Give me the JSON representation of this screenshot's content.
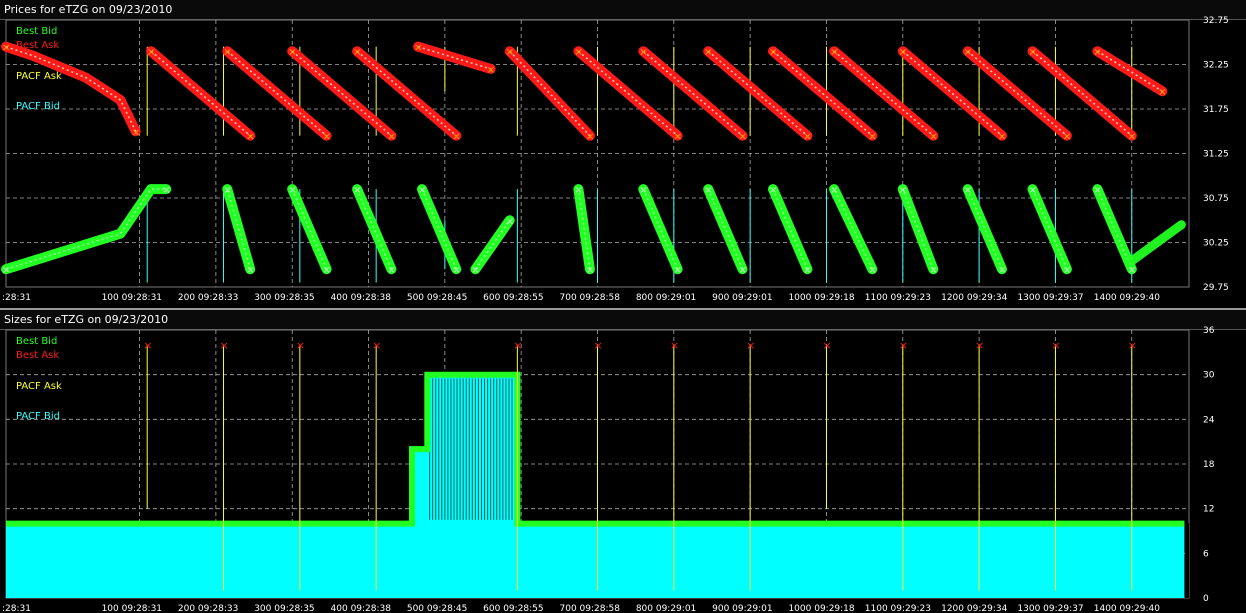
{
  "chart_data": [
    {
      "type": "line",
      "title": "Prices for  eTZG  on  09/23/2010",
      "x_tick_labels": [
        ":28:31",
        "100 09:28:31",
        "200 09:28:33",
        "300 09:28:35",
        "400 09:28:38",
        "500 09:28:45",
        "600 09:28:55",
        "700 09:28:58",
        "800 09:29:01",
        "900 09:29:01",
        "1000 09:29:18",
        "1100 09:29:23",
        "1200 09:29:34",
        "1300 09:29:37",
        "1400 09:29:40"
      ],
      "y_tick_labels": [
        "32.75",
        "32.25",
        "31.75",
        "31.25",
        "30.75",
        "30.25",
        "29.75"
      ],
      "ylim": [
        29.75,
        32.75
      ],
      "xlim": [
        -75,
        1475
      ],
      "grid": true,
      "legend": [
        "Best Bid",
        "Best Ask",
        "PACF Ask",
        "PACF Bid"
      ],
      "legend_position": "top-left",
      "series": [
        {
          "name": "Best Ask",
          "color": "#ff1a1a",
          "x": [
            -75,
            -40,
            30,
            75,
            95,
            115,
            245,
            215,
            345,
            300,
            430,
            385,
            515,
            465,
            560,
            585,
            690,
            675,
            805,
            760,
            890,
            845,
            975,
            930,
            1060,
            1010,
            1140,
            1100,
            1230,
            1185,
            1315,
            1270,
            1400,
            1355,
            1440
          ],
          "y": [
            32.45,
            32.35,
            32.1,
            31.85,
            31.5,
            32.4,
            31.45,
            32.4,
            31.45,
            32.4,
            31.45,
            32.4,
            31.45,
            32.45,
            32.2,
            32.4,
            31.45,
            32.4,
            31.45,
            32.4,
            31.45,
            32.4,
            31.45,
            32.4,
            31.45,
            32.4,
            31.45,
            32.4,
            31.45,
            32.4,
            31.45,
            32.4,
            31.45,
            32.4,
            31.95
          ],
          "segments": [
            [
              0,
              4
            ],
            [
              5,
              6
            ],
            [
              7,
              8
            ],
            [
              9,
              10
            ],
            [
              11,
              12
            ],
            [
              13,
              14
            ],
            [
              15,
              16
            ],
            [
              17,
              18
            ],
            [
              19,
              20
            ],
            [
              21,
              22
            ],
            [
              23,
              24
            ],
            [
              25,
              26
            ],
            [
              27,
              28
            ],
            [
              29,
              30
            ],
            [
              31,
              32
            ],
            [
              33,
              34
            ]
          ]
        },
        {
          "name": "Best Bid",
          "color": "#22ff22",
          "x": [
            -75,
            75,
            115,
            135,
            245,
            215,
            345,
            300,
            430,
            385,
            515,
            470,
            540,
            585,
            690,
            675,
            805,
            760,
            890,
            845,
            975,
            930,
            1060,
            1010,
            1140,
            1100,
            1230,
            1185,
            1315,
            1270,
            1400,
            1355,
            1465
          ],
          "y": [
            29.95,
            30.35,
            30.85,
            30.85,
            29.95,
            30.85,
            29.95,
            30.85,
            29.95,
            30.85,
            29.95,
            30.85,
            29.95,
            30.5,
            29.95,
            30.85,
            29.95,
            30.85,
            29.95,
            30.85,
            29.95,
            30.85,
            29.95,
            30.85,
            29.95,
            30.85,
            29.95,
            30.85,
            29.95,
            30.85,
            29.95,
            30.85,
            30.45
          ],
          "segments": [
            [
              0,
              3
            ],
            [
              4,
              5
            ],
            [
              6,
              7
            ],
            [
              8,
              9
            ],
            [
              10,
              11
            ],
            [
              12,
              13
            ],
            [
              14,
              15
            ],
            [
              16,
              17
            ],
            [
              18,
              19
            ],
            [
              20,
              21
            ],
            [
              22,
              23
            ],
            [
              24,
              25
            ],
            [
              26,
              27
            ],
            [
              28,
              29
            ],
            [
              30,
              31
            ],
            [
              32,
              32
            ]
          ]
        },
        {
          "name": "PACF Ask",
          "color": "#ffff33",
          "verticals_x": [
            110,
            210,
            310,
            410,
            500,
            595,
            700,
            800,
            900,
            1000,
            1100,
            1200,
            1300,
            1400
          ],
          "verticals_y": [
            [
              31.45,
              32.45
            ],
            [
              31.45,
              32.45
            ],
            [
              31.45,
              32.45
            ],
            [
              31.45,
              32.45
            ],
            [
              31.95,
              32.45
            ],
            [
              31.45,
              32.45
            ],
            [
              31.45,
              32.45
            ],
            [
              31.45,
              32.45
            ],
            [
              31.45,
              32.45
            ],
            [
              31.45,
              32.45
            ],
            [
              31.45,
              32.45
            ],
            [
              31.45,
              32.45
            ],
            [
              31.45,
              32.45
            ],
            [
              31.45,
              32.45
            ]
          ]
        },
        {
          "name": "PACF Bid",
          "color": "#33ffff",
          "verticals_x": [
            110,
            210,
            310,
            410,
            500,
            595,
            700,
            800,
            900,
            1000,
            1100,
            1200,
            1300,
            1400
          ],
          "verticals_y": [
            [
              29.8,
              30.85
            ],
            [
              29.8,
              30.85
            ],
            [
              29.8,
              30.85
            ],
            [
              29.8,
              30.85
            ],
            [
              29.95,
              30.5
            ],
            [
              29.8,
              30.85
            ],
            [
              29.8,
              30.85
            ],
            [
              29.8,
              30.85
            ],
            [
              29.8,
              30.85
            ],
            [
              29.8,
              30.85
            ],
            [
              29.8,
              30.85
            ],
            [
              29.8,
              30.85
            ],
            [
              29.8,
              30.85
            ],
            [
              29.8,
              30.85
            ]
          ]
        }
      ]
    },
    {
      "type": "area",
      "title": "Sizes for  eTZG  on  09/23/2010",
      "x_tick_labels": [
        ":28:31",
        "100 09:28:31",
        "200 09:28:33",
        "300 09:28:35",
        "400 09:28:38",
        "500 09:28:45",
        "600 09:28:55",
        "700 09:28:58",
        "800 09:29:01",
        "900 09:29:01",
        "1000 09:29:18",
        "1100 09:29:23",
        "1200 09:29:34",
        "1300 09:29:37",
        "1400 09:29:40"
      ],
      "y_tick_labels": [
        "36",
        "30",
        "24",
        "18",
        "12",
        "6",
        "0"
      ],
      "ylim": [
        0,
        36
      ],
      "xlim": [
        -75,
        1475
      ],
      "grid": true,
      "legend": [
        "Best Bid",
        "Best Ask",
        "PACF Ask",
        "PACF Bid"
      ],
      "legend_position": "top-left",
      "series": [
        {
          "name": "PACF Bid",
          "color": "#00ffff",
          "x": [
            -75,
            457,
            457,
            477,
            477,
            595,
            595,
            1469
          ],
          "y": [
            10,
            10,
            20,
            20,
            30,
            30,
            10,
            10
          ]
        },
        {
          "name": "Best Bid",
          "color": "#22ff22",
          "x": [
            -75,
            457,
            457,
            477,
            477,
            595,
            595,
            1469
          ],
          "y": [
            10,
            10,
            20,
            20,
            30,
            30,
            10,
            10
          ]
        },
        {
          "name": "Best Ask",
          "color": "#ff1a1a",
          "markers_y": 34,
          "markers_x": [
            110,
            210,
            310,
            410,
            595,
            700,
            800,
            900,
            1000,
            1100,
            1200,
            1300,
            1400
          ]
        },
        {
          "name": "PACF Ask",
          "color": "#ffff33",
          "verticals_x": [
            110,
            210,
            310,
            410,
            595,
            700,
            800,
            900,
            1000,
            1100,
            1200,
            1300,
            1400
          ],
          "verticals_y": [
            [
              12,
              34
            ],
            [
              1,
              34
            ],
            [
              1,
              34
            ],
            [
              1,
              34
            ],
            [
              1,
              34
            ],
            [
              1,
              34
            ],
            [
              1,
              34
            ],
            [
              1,
              34
            ],
            [
              12,
              34
            ],
            [
              1,
              34
            ],
            [
              1,
              34
            ],
            [
              1,
              34
            ],
            [
              1,
              34
            ]
          ]
        }
      ]
    }
  ]
}
